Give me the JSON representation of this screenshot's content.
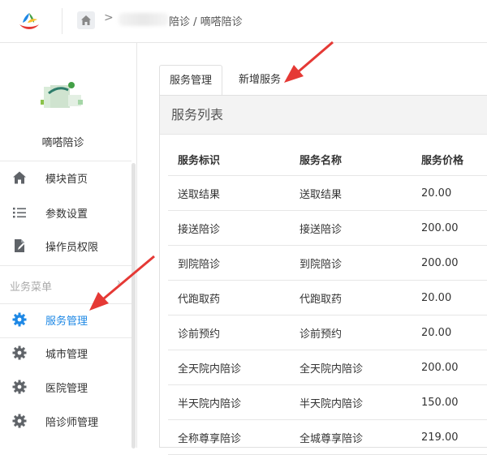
{
  "header": {
    "breadcrumb_sep": ">",
    "breadcrumb_text": "陪诊 / 嘀嗒陪诊"
  },
  "sidebar": {
    "module_name": "嘀嗒陪诊",
    "items_top": [
      {
        "label": "模块首页",
        "icon": "home-icon"
      },
      {
        "label": "参数设置",
        "icon": "list-icon"
      },
      {
        "label": "操作员权限",
        "icon": "document-edit-icon"
      }
    ],
    "section_label": "业务菜单",
    "section_chevron": "›",
    "items_business": [
      {
        "label": "服务管理",
        "icon": "gear-icon",
        "active": true
      },
      {
        "label": "城市管理",
        "icon": "gear-icon",
        "active": false
      },
      {
        "label": "医院管理",
        "icon": "gear-icon",
        "active": false
      },
      {
        "label": "陪诊师管理",
        "icon": "gear-icon",
        "active": false
      }
    ]
  },
  "tabs": [
    {
      "label": "服务管理",
      "active": true
    },
    {
      "label": "新增服务",
      "active": false
    }
  ],
  "panel": {
    "title": "服务列表",
    "columns": [
      "服务标识",
      "服务名称",
      "服务价格"
    ],
    "rows": [
      [
        "送取结果",
        "送取结果",
        "20.00"
      ],
      [
        "接送陪诊",
        "接送陪诊",
        "200.00"
      ],
      [
        "到院陪诊",
        "到院陪诊",
        "200.00"
      ],
      [
        "代跑取药",
        "代跑取药",
        "20.00"
      ],
      [
        "诊前预约",
        "诊前预约",
        "20.00"
      ],
      [
        "全天院内陪诊",
        "全天院内陪诊",
        "200.00"
      ],
      [
        "半天院内陪诊",
        "半天院内陪诊",
        "150.00"
      ],
      [
        "全称尊享陪诊",
        "全城尊享陪诊",
        "219.00"
      ]
    ]
  },
  "colors": {
    "accent": "#1e88e5",
    "arrow": "#e53935",
    "icon_gray": "#5f6368"
  }
}
